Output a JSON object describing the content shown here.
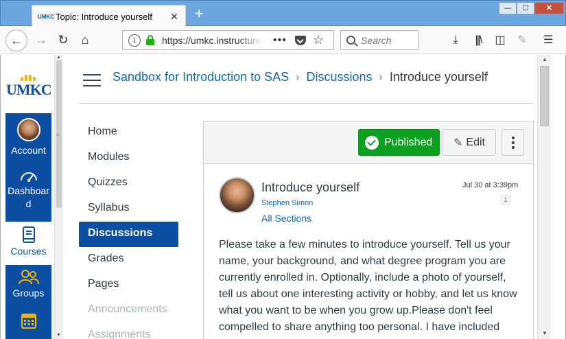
{
  "browser": {
    "tab_title": "Topic: Introduce yourself",
    "tab_favicon_text": "UMKC",
    "url": "https://umkc.instructure.com/courses",
    "search_placeholder": "Search"
  },
  "global_nav": {
    "logo_text": "UMKC",
    "items": [
      {
        "label": "Account"
      },
      {
        "label": "Dashboard"
      },
      {
        "label": "Courses"
      },
      {
        "label": "Groups"
      },
      {
        "label": "Calendar"
      }
    ],
    "dashboard_line1": "Dashboar",
    "dashboard_line2": "d",
    "brand_color": "#0b4ea2"
  },
  "breadcrumb": {
    "course": "Sandbox for Introduction to SAS",
    "section": "Discussions",
    "current": "Introduce yourself"
  },
  "course_nav": [
    "Home",
    "Modules",
    "Quizzes",
    "Syllabus",
    "Discussions",
    "Grades",
    "Pages",
    "Announcements",
    "Assignments"
  ],
  "toolbar": {
    "published_label": "Published",
    "edit_label": "Edit",
    "published_color": "#0ea121"
  },
  "post": {
    "title": "Introduce yourself",
    "author": "Stephen Simon",
    "sections": "All Sections",
    "date": "Jul 30 at 3:39pm",
    "badge": "1",
    "body": "Please take a few minutes to introduce yourself. Tell us your name, your background, and what degree program you are currently enrolled in. Optionally, include a photo of yourself, tell us about one interesting activity or hobby, and let us know what you want to be when you grow up.Please don't feel compelled to share anything too personal. I have included"
  }
}
